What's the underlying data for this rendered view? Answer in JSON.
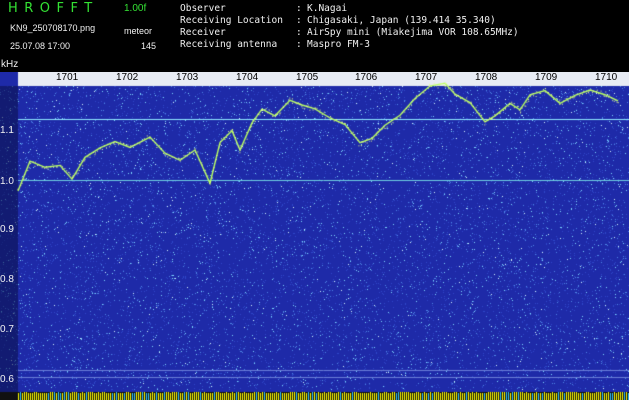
{
  "header": {
    "app_title": "HROFFT",
    "version": "1.00f",
    "filename": "KN9_250708170.png",
    "datetime": "25.07.08 17:00",
    "mode": "meteor",
    "count": "145"
  },
  "meta": [
    {
      "key": "Observer",
      "value": "K.Nagai"
    },
    {
      "key": "Receiving Location",
      "value": "Chigasaki, Japan (139.414 35.340)"
    },
    {
      "key": "Receiver",
      "value": "AirSpy mini (Miakejima VOR 108.65MHz)"
    },
    {
      "key": "Receiving antenna",
      "value": "Maspro FM-3"
    }
  ],
  "separator": ":",
  "plot": {
    "freq_unit": "kHz",
    "freq_ticks": [
      "1.1",
      "1.0",
      "0.9",
      "0.8",
      "0.7",
      "0.6"
    ],
    "time_ticks": [
      "1701",
      "1702",
      "1703",
      "1704",
      "1705",
      "1706",
      "1707",
      "1708",
      "1709",
      "1710"
    ],
    "colors": {
      "background": "#1e2aa8",
      "noise": "#7fd8ff",
      "trace": "#b8ff60",
      "time_bar": "#ffff00"
    }
  }
}
